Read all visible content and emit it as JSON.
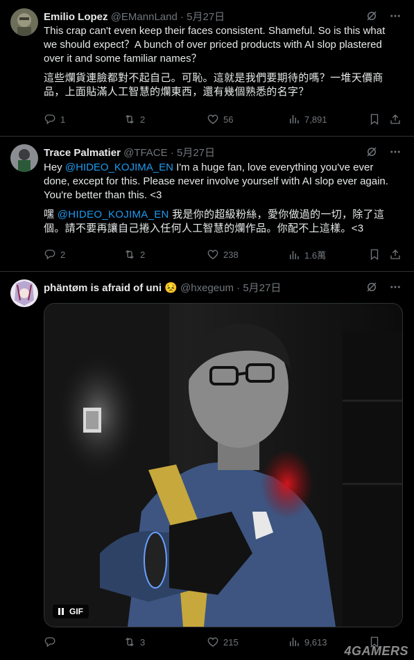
{
  "tweets": [
    {
      "name": "Emilio Lopez",
      "handle": "@EMannLand",
      "dot": "·",
      "date": "5月27日",
      "text_en": "This crap can't even keep their faces consistent. Shameful. So is this what we should expect？A bunch of over priced products with AI slop plastered over it and some familiar names？",
      "text_zh": "這些爛貨連臉都對不起自己。可恥。這就是我們要期待的嗎？一堆天價商品，上面貼滿人工智慧的爛東西，還有幾個熟悉的名字？",
      "replies": "1",
      "reposts": "2",
      "likes": "56",
      "views": "7,891"
    },
    {
      "name": "Trace Palmatier",
      "handle": "@TFACE",
      "dot": "·",
      "date": "5月27日",
      "text_en_pre": "Hey ",
      "mention": "@HIDEO_KOJIMA_EN",
      "text_en_post": " I'm a huge fan, love everything you've ever done, except for this. Please never involve yourself with AI slop ever again. You're better than this. <3",
      "text_zh_pre": "嘿 ",
      "text_zh_post": " 我是你的超級粉絲，愛你做過的一切，除了這個。請不要再讓自己捲入任何人工智慧的爛作品。你配不上這樣。<3",
      "replies": "2",
      "reposts": "2",
      "likes": "238",
      "views": "1.6萬"
    },
    {
      "name": "phäntøm is afraid of uni",
      "emoji": "😣",
      "handle": "@hxegeum",
      "dot": "·",
      "date": "5月27日",
      "gif_label": "GIF",
      "replies": "",
      "reposts": "3",
      "likes": "215",
      "views": "9,613"
    }
  ],
  "watermark": "4GAMERS",
  "icons": [
    "grok-icon",
    "more-icon",
    "reply-icon",
    "repost-icon",
    "like-icon",
    "views-icon",
    "bookmark-icon",
    "share-icon"
  ],
  "colors": {
    "background": "#000000",
    "text": "#e7e9ea",
    "muted": "#71767b",
    "link": "#1d9bf0",
    "divider": "#2f3336"
  }
}
